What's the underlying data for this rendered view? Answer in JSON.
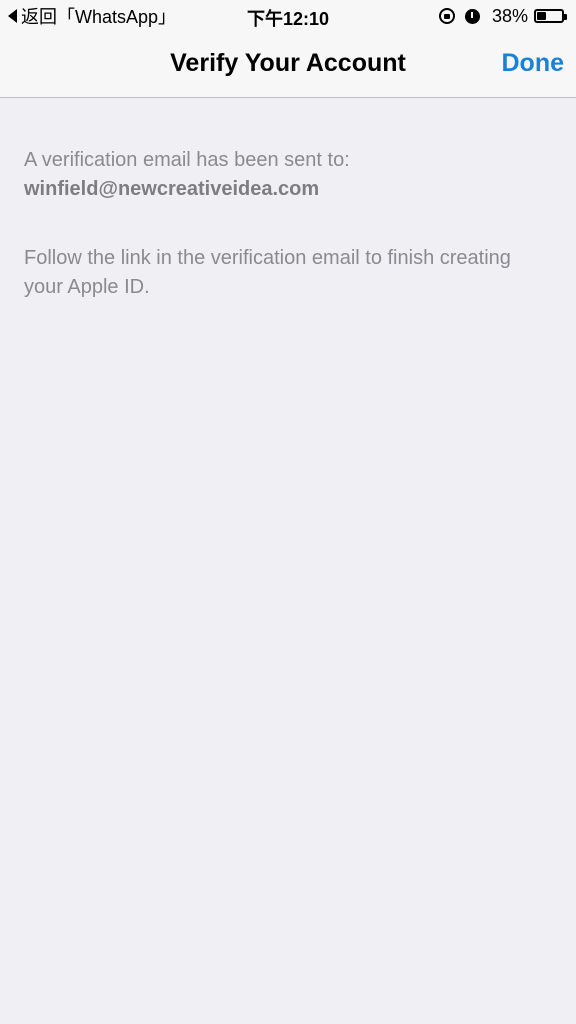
{
  "status_bar": {
    "back_label": "返回「WhatsApp」",
    "time": "下午12:10",
    "battery_percent_label": "38%",
    "battery_level": 0.38,
    "icons": [
      "orientation-lock-icon",
      "alarm-icon",
      "battery-icon"
    ]
  },
  "nav": {
    "title": "Verify Your Account",
    "done_label": "Done"
  },
  "content": {
    "sent_message": "A verification email has been sent to:",
    "email": "winfield@newcreativeidea.com",
    "instructions": "Follow the link in the verification email to finish creating your Apple ID."
  },
  "colors": {
    "background": "#efeff4",
    "accent": "#1a82d6",
    "secondary_text": "#8a8a8f"
  }
}
